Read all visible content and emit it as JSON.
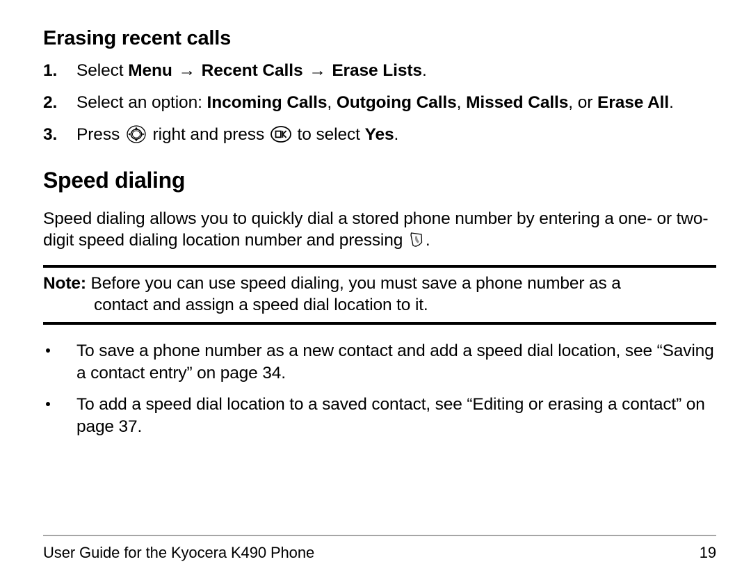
{
  "document": {
    "title": "Erasing recent calls",
    "page_number": "19",
    "footer_text": "User Guide for the Kyocera K490 Phone"
  },
  "section_erasing": {
    "heading": "Erasing recent calls",
    "steps": [
      {
        "number": "1.",
        "parts": [
          {
            "text": "Select ",
            "bold": false
          },
          {
            "text": "Menu",
            "bold": true
          },
          {
            "text": " → ",
            "bold": false,
            "arrow": true
          },
          {
            "text": "Recent Calls",
            "bold": true
          },
          {
            "text": " → ",
            "bold": false,
            "arrow": true
          },
          {
            "text": "Erase Lists",
            "bold": true
          },
          {
            "text": ".",
            "bold": false
          }
        ],
        "plain": "Select Menu → Recent Calls → Erase Lists."
      },
      {
        "number": "2.",
        "parts": [
          {
            "text": "Select an option: ",
            "bold": false
          },
          {
            "text": "Incoming Calls",
            "bold": true
          },
          {
            "text": ", ",
            "bold": false
          },
          {
            "text": "Outgoing Calls",
            "bold": true
          },
          {
            "text": ", ",
            "bold": false
          },
          {
            "text": "Missed Calls",
            "bold": true
          },
          {
            "text": ", or ",
            "bold": false
          },
          {
            "text": "Erase All",
            "bold": true
          },
          {
            "text": ".",
            "bold": false
          }
        ],
        "plain": "Select an option: Incoming Calls, Outgoing Calls, Missed Calls, or Erase All."
      },
      {
        "number": "3.",
        "plain": "Press [navigation-key] right and press [ok-key] to select Yes.",
        "text_before_nav": "Press ",
        "text_after_nav": " right and press ",
        "text_after_ok": " to select ",
        "bold_word": "Yes",
        "text_end": "."
      }
    ]
  },
  "section_speed_dialing": {
    "heading": "Speed dialing",
    "intro_before_icon": "Speed dialing allows you to quickly dial a stored phone number by entering a one- or two-digit speed dialing location number and pressing ",
    "intro_after_icon": ".",
    "note": {
      "label": "Note:",
      "line1": " Before you can use speed dialing, you must save a phone number as a",
      "line2": "contact and assign a speed dial location to it."
    },
    "bullets": [
      "To save a phone number as a new contact and add a speed dial location, see “Saving a contact entry” on page 34.",
      "To add a speed dial location to a saved contact, see “Editing or erasing a contact” on page 37."
    ]
  },
  "icons": {
    "navigation_key": "navigation-key-icon",
    "ok_key": "ok-key-icon",
    "send_key": "send-key-icon",
    "ok_label": "OK"
  },
  "colors": {
    "text": "#000000",
    "note_rule": "#000000",
    "footer_rule": "#a6a6a6",
    "background": "#ffffff"
  }
}
